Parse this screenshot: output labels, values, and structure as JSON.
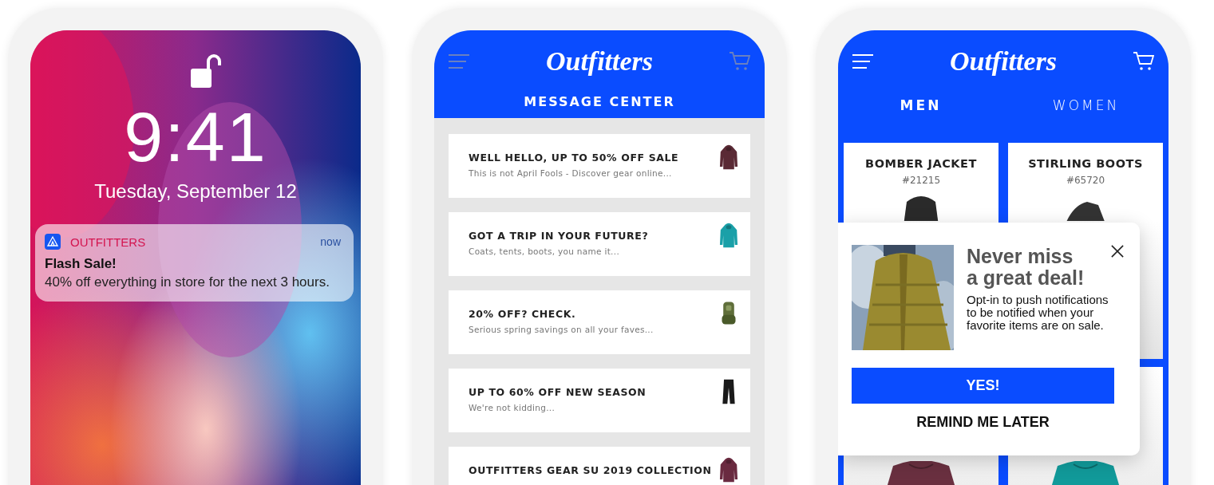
{
  "lock_screen": {
    "time": "9:41",
    "date": "Tuesday, September 12",
    "notification": {
      "app": "OUTFITTERS",
      "time": "now",
      "title": "Flash Sale!",
      "body": "40% off everything in store for the next 3 hours."
    }
  },
  "message_center": {
    "logo": "Outfitters",
    "title": "MESSAGE CENTER",
    "messages": [
      {
        "title": "WELL HELLO, UP TO 50% OFF SALE",
        "preview": "This is not April Fools - Discover gear online..."
      },
      {
        "title": "GOT A TRIP IN YOUR FUTURE?",
        "preview": "Coats, tents, boots, you name it..."
      },
      {
        "title": "20% OFF? CHECK.",
        "preview": "Serious spring savings on all your faves..."
      },
      {
        "title": "UP TO 60% OFF NEW SEASON",
        "preview": "We're not kidding..."
      },
      {
        "title": "OUTFITTERS GEAR SU 2019 COLLECTION"
      }
    ]
  },
  "shop": {
    "logo": "Outfitters",
    "tabs": [
      {
        "label": "MEN",
        "selected": true
      },
      {
        "label": "WOMEN",
        "selected": false
      }
    ],
    "products": [
      {
        "name": "BOMBER JACKET",
        "sku": "#21215"
      },
      {
        "name": "STIRLING BOOTS",
        "sku": "#65720"
      }
    ],
    "popup": {
      "title_lines": [
        "Never miss",
        "a great deal!"
      ],
      "body": "Opt-in to push notifications to be notified when your favorite items are on sale.",
      "primary_button": "YES!",
      "secondary_button": "REMIND ME LATER"
    }
  }
}
